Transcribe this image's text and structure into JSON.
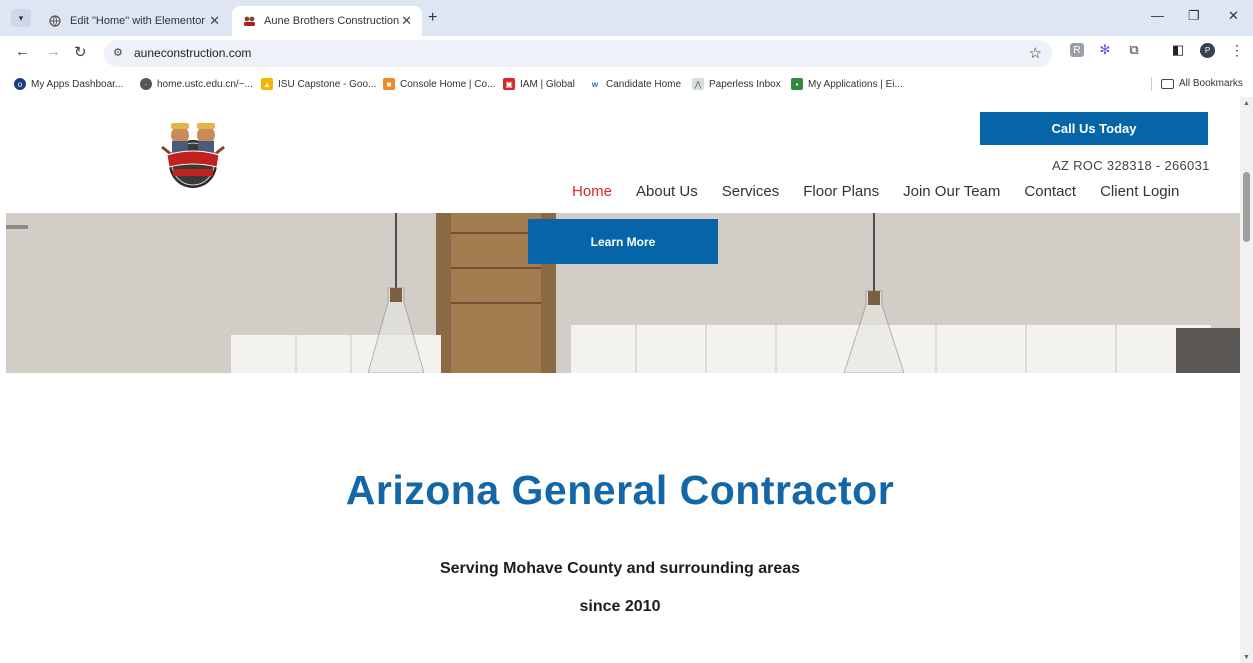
{
  "browser": {
    "tabs": [
      {
        "title": "Edit \"Home\" with Elementor",
        "active": false,
        "icon": "globe-icon"
      },
      {
        "title": "Aune Brothers Construction",
        "active": true,
        "icon": "site-favicon"
      }
    ],
    "url": "auneconstruction.com",
    "profile_initial": "P",
    "bookmarks": [
      {
        "label": "My Apps Dashboar...",
        "icon": "circle-icon",
        "color": "#1a3f7a"
      },
      {
        "label": "home.ustc.edu.cn/~...",
        "icon": "globe-icon",
        "color": "#555555"
      },
      {
        "label": "ISU Capstone - Goo...",
        "icon": "drive-icon",
        "color": "#f4b400"
      },
      {
        "label": "Console Home | Co...",
        "icon": "cube-icon",
        "color": "#f08a24"
      },
      {
        "label": "IAM | Global",
        "icon": "iam-icon",
        "color": "#d9262d"
      },
      {
        "label": "Candidate Home",
        "icon": "workday-icon",
        "color": "#f5a623"
      },
      {
        "label": "Paperless Inbox",
        "icon": "paperless-icon",
        "color": "#6b8a6e"
      },
      {
        "label": "My Applications | Ei...",
        "icon": "apps-icon",
        "color": "#2e8b3a"
      }
    ],
    "all_bookmarks": "All Bookmarks"
  },
  "site": {
    "call_button": "Call Us Today",
    "license": "AZ ROC 328318 - 266031",
    "logo_text": "AUNE BROTHERS",
    "nav": [
      {
        "label": "Home",
        "current": true
      },
      {
        "label": "About Us",
        "current": false
      },
      {
        "label": "Services",
        "current": false
      },
      {
        "label": "Floor Plans",
        "current": false
      },
      {
        "label": "Join Our Team",
        "current": false
      },
      {
        "label": "Contact",
        "current": false
      },
      {
        "label": "Client Login",
        "current": false
      }
    ],
    "learn_more": "Learn More",
    "headline": "Arizona General Contractor",
    "subheading_1": "Serving Mohave County and surrounding areas",
    "subheading_2": "since 2010"
  },
  "colors": {
    "brand_blue": "#0565a8",
    "headline_blue": "#1367a6",
    "nav_active": "#d72a2a"
  }
}
